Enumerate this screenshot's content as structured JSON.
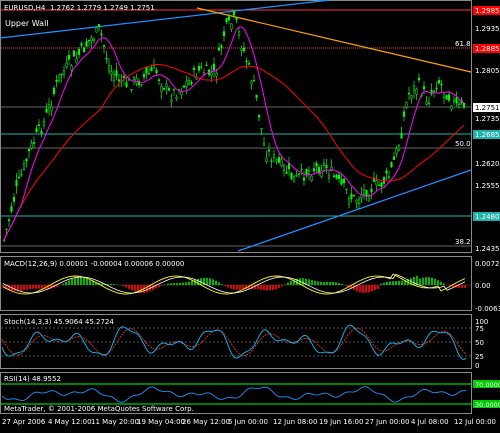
{
  "header": {
    "symbol": "EURUSD,H4",
    "ohlc": "1.2762 1.2779 1.2749 1.2751",
    "annotation": "Upper Wall"
  },
  "colors": {
    "background": "#000000",
    "bull_candle": "#00ff00",
    "bear_candle": "#00ff00",
    "ma_fast": "#ff00ff",
    "ma_slow": "#ff0000",
    "trendline_blue": "#1e90ff",
    "trendline_orange": "#ffa500",
    "fib_red": "#ff3333",
    "level_cyan": "#20b2aa",
    "macd_hist_pos": "#00cc00",
    "macd_hist_neg": "#ff0000",
    "macd_main": "#ffff00",
    "macd_signal": "#ffffff",
    "stoch_main": "#00bfff",
    "stoch_signal": "#ff3333",
    "rsi_line": "#1e90ff",
    "rsi_band": "#00ff00"
  },
  "price_axis": {
    "labels": [
      "1.2985",
      "1.2935",
      "1.2885",
      "1.2805",
      "1.2751",
      "1.2735",
      "1.2685",
      "1.2620",
      "1.2555",
      "1.2480",
      "1.2435"
    ],
    "highlight": [
      {
        "text": "1.2985",
        "color": "#ff0000"
      },
      {
        "text": "1.2885",
        "color": "#ff0000"
      },
      {
        "text": "1.2751",
        "color": "#ffffff"
      },
      {
        "text": "1.2685",
        "color": "#20b2aa"
      },
      {
        "text": "1.2480",
        "color": "#20b2aa"
      }
    ]
  },
  "fib_labels": {
    "f61": "61.8",
    "f50": "50.0",
    "f38": "38.2"
  },
  "macd": {
    "label": "MACD(12,26,9) 0.00001 -0.00004 0.00006 0.00000",
    "axis": [
      "0.00724",
      "0.00",
      "-0.00637"
    ]
  },
  "stoch": {
    "label": "Stoch(14,3,3) 45.9064 45.2724",
    "axis": [
      "100",
      "75",
      "50",
      "25",
      "0"
    ]
  },
  "rsi": {
    "label": "RSI(14) 48.9552",
    "axis": [
      "70.0000",
      "30.0000"
    ]
  },
  "copyright": "MetaTrader, © 2001-2006 MetaQuotes Software Corp.",
  "time_axis": [
    "27 Apr 2006",
    "4 May 12:00",
    "11 May 20:00",
    "19 May 04:00",
    "26 May 12:00",
    "5 Jun 00:00",
    "12 Jun 08:00",
    "19 Jun 16:00",
    "27 Jun 00:00",
    "4 Jul 08:00",
    "12 Jul 00:00"
  ]
}
